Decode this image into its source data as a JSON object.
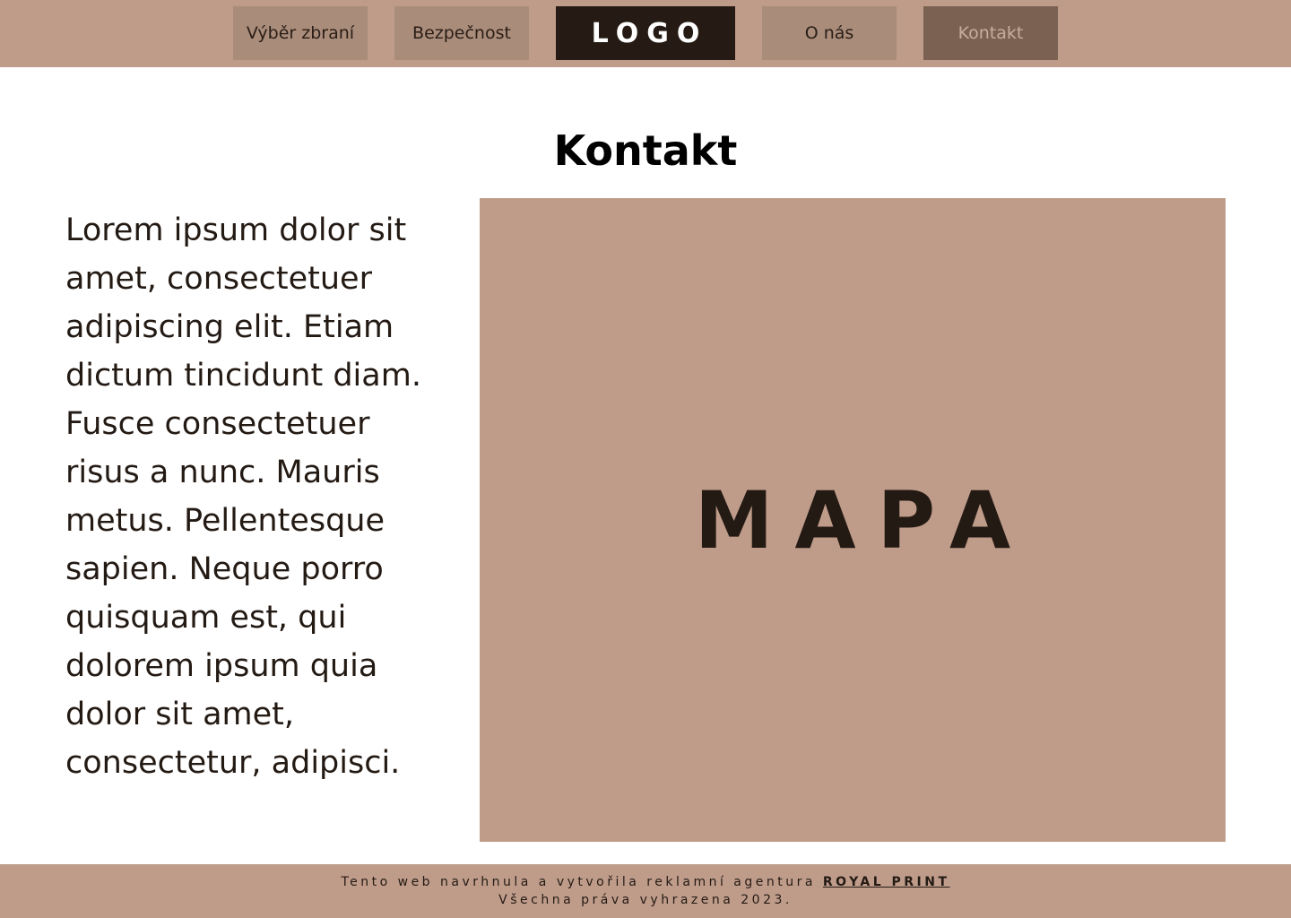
{
  "nav": {
    "item1": "Výběr zbraní",
    "item2": "Bezpečnost",
    "logo": "LOGO",
    "item4": "O nás",
    "item5": "Kontakt"
  },
  "main": {
    "title": "Kontakt",
    "text": "Lorem ipsum dolor sit amet, consectetuer adipiscing elit. Etiam dictum tincidunt diam. Fusce consectetuer risus a nunc. Mauris metus. Pellentesque sapien. Neque porro quisquam est, qui dolorem ipsum quia dolor sit amet, consectetur, adipisci.",
    "map_label": "MAPA"
  },
  "footer": {
    "credit_text": "Tento web navrhnula a vytvořila reklamní agentura ",
    "agency_name": "ROYAL PRINT",
    "copyright": "Všechna práva vyhrazena 2023."
  },
  "colors": {
    "accent": "#bf9c8a",
    "nav_button": "#a98c7a",
    "active_nav": "#7a6152",
    "dark": "#261b14"
  }
}
